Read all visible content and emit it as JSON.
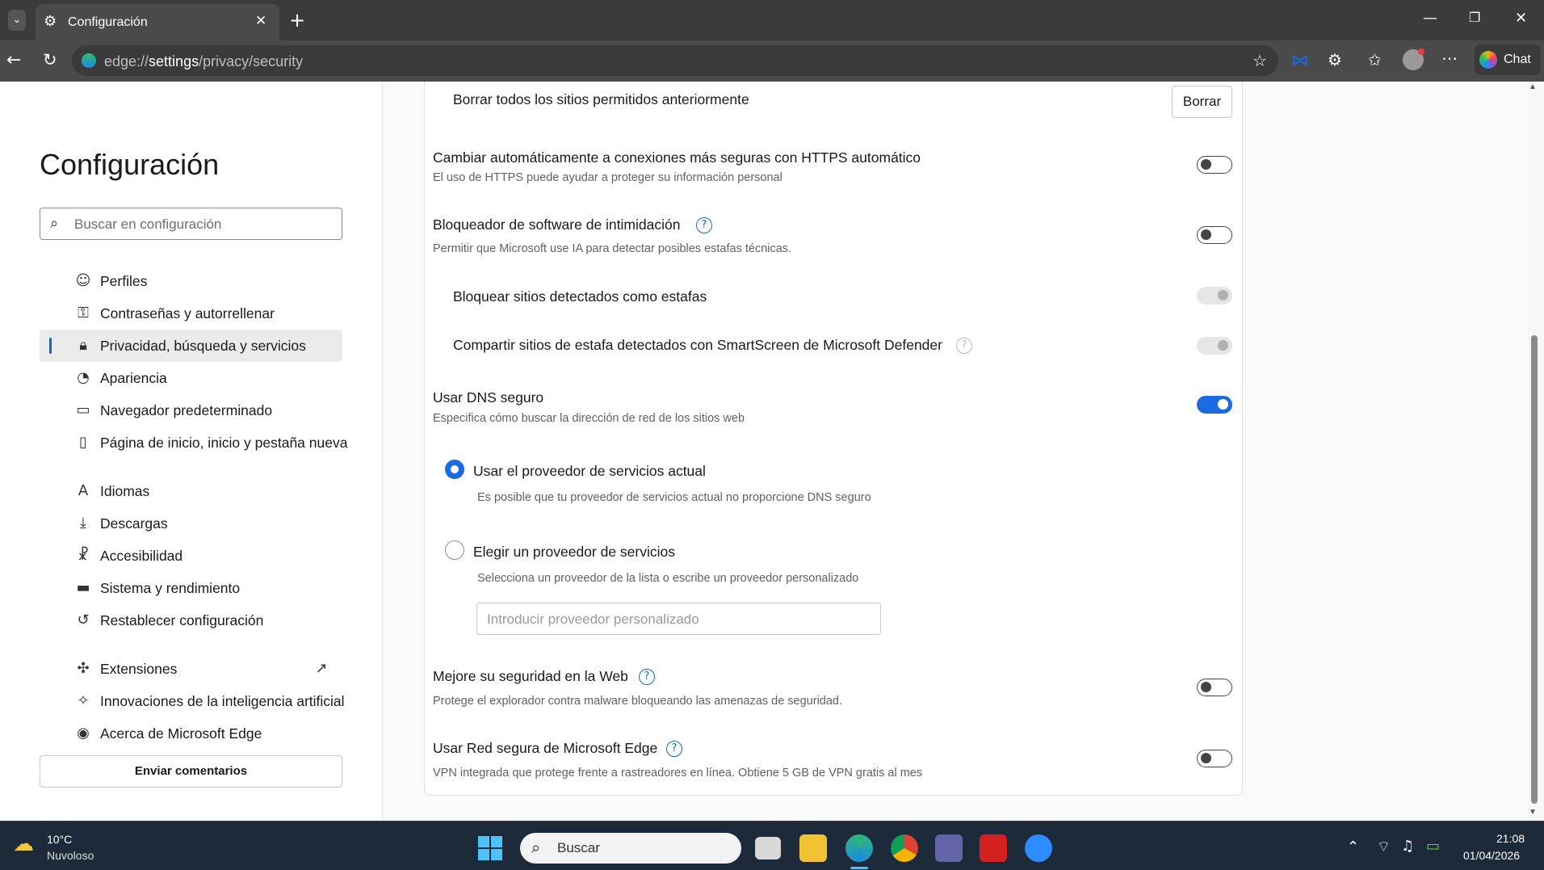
{
  "browser": {
    "tab_title": "Configuración",
    "url_prefix": "edge://",
    "url_host": "settings",
    "url_path": "/privacy/security",
    "chat_label": "Chat"
  },
  "sidebar": {
    "title": "Configuración",
    "search_placeholder": "Buscar en configuración",
    "items": [
      {
        "label": "Perfiles",
        "icon": "profile-icon"
      },
      {
        "label": "Contraseñas y autorrellenar",
        "icon": "key-icon"
      },
      {
        "label": "Privacidad, búsqueda y servicios",
        "icon": "lock-icon",
        "active": true
      },
      {
        "label": "Apariencia",
        "icon": "palette-icon"
      },
      {
        "label": "Navegador predeterminado",
        "icon": "browser-icon"
      },
      {
        "label": "Página de inicio, inicio y pestaña nueva",
        "icon": "home-page-icon"
      },
      {
        "label": "Idiomas",
        "icon": "language-icon"
      },
      {
        "label": "Descargas",
        "icon": "download-icon"
      },
      {
        "label": "Accesibilidad",
        "icon": "accessibility-icon"
      },
      {
        "label": "Sistema y rendimiento",
        "icon": "laptop-icon"
      },
      {
        "label": "Restablecer configuración",
        "icon": "reset-icon"
      },
      {
        "label": "Extensiones",
        "icon": "puzzle-icon"
      },
      {
        "label": "Innovaciones de la inteligencia artificial",
        "icon": "ai-icon"
      },
      {
        "label": "Acerca de Microsoft Edge",
        "icon": "edge-icon"
      }
    ],
    "feedback_label": "Enviar comentarios"
  },
  "settings": {
    "clear_sites": {
      "title": "Borrar todos los sitios permitidos anteriormente",
      "button": "Borrar"
    },
    "https": {
      "title": "Cambiar automáticamente a conexiones más seguras con HTTPS automático",
      "desc": "El uso de HTTPS puede ayudar a proteger su información personal",
      "on": false
    },
    "scareware": {
      "title": "Bloqueador de software de intimidación",
      "desc": "Permitir que Microsoft use IA para detectar posibles estafas técnicas.",
      "on": false
    },
    "block_scam": {
      "title": "Bloquear sitios detectados como estafas",
      "on": true,
      "disabled": true
    },
    "share_scam": {
      "title": "Compartir sitios de estafa detectados con SmartScreen de Microsoft Defender",
      "on": true,
      "disabled": true
    },
    "dns": {
      "title": "Usar DNS seguro",
      "desc": "Especifica cómo buscar la dirección de red de los sitios web",
      "on": true
    },
    "dns_current": {
      "title": "Usar el proveedor de servicios actual",
      "desc": "Es posible que tu proveedor de servicios actual no proporcione DNS seguro",
      "selected": true
    },
    "dns_choose": {
      "title": "Elegir un proveedor de servicios",
      "desc": "Selecciona un proveedor de la lista o escribe un proveedor personalizado",
      "selected": false,
      "placeholder": "Introducir proveedor personalizado"
    },
    "web_security": {
      "title": "Mejore su seguridad en la Web",
      "desc": "Protege el explorador contra malware bloqueando las amenazas de seguridad.",
      "on": false
    },
    "secure_network": {
      "title": "Usar Red segura de Microsoft Edge",
      "desc": "VPN integrada que protege frente a rastreadores en línea. Obtiene 5 GB de VPN gratis al mes",
      "on": false
    }
  },
  "taskbar": {
    "weather_temp": "10°C",
    "weather_desc": "Nuvoloso",
    "search_placeholder": "Buscar",
    "time": "21:08",
    "date": "01/04/2026"
  },
  "colors": {
    "accent": "#1a6ae0",
    "taskbar": "#1d2a3a",
    "titlebar": "#3b3b3b"
  }
}
